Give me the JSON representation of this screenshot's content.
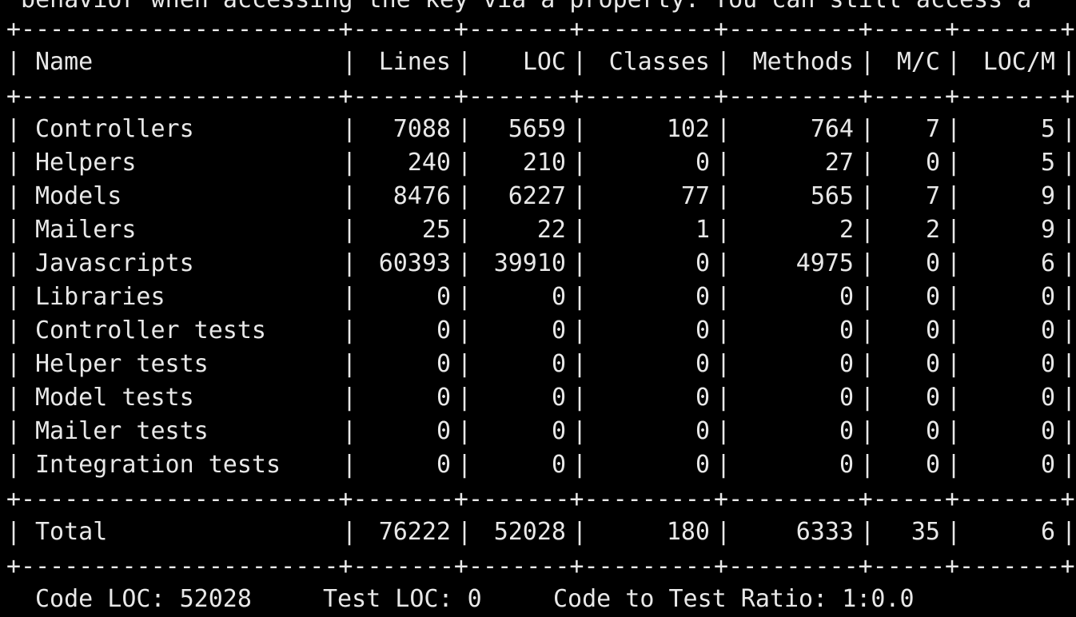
{
  "top_text": " behavior when accessing the key via a property. You can still access a",
  "separator": "+----------------------+-------+-------+---------+---------+-----+-------+",
  "columns": [
    "Name",
    "Lines",
    "LOC",
    "Classes",
    "Methods",
    "M/C",
    "LOC/M"
  ],
  "rows": [
    {
      "name": "Controllers",
      "lines": "7088",
      "loc": "5659",
      "classes": "102",
      "methods": "764",
      "mc": "7",
      "locm": "5"
    },
    {
      "name": "Helpers",
      "lines": "240",
      "loc": "210",
      "classes": "0",
      "methods": "27",
      "mc": "0",
      "locm": "5"
    },
    {
      "name": "Models",
      "lines": "8476",
      "loc": "6227",
      "classes": "77",
      "methods": "565",
      "mc": "7",
      "locm": "9"
    },
    {
      "name": "Mailers",
      "lines": "25",
      "loc": "22",
      "classes": "1",
      "methods": "2",
      "mc": "2",
      "locm": "9"
    },
    {
      "name": "Javascripts",
      "lines": "60393",
      "loc": "39910",
      "classes": "0",
      "methods": "4975",
      "mc": "0",
      "locm": "6"
    },
    {
      "name": "Libraries",
      "lines": "0",
      "loc": "0",
      "classes": "0",
      "methods": "0",
      "mc": "0",
      "locm": "0"
    },
    {
      "name": "Controller tests",
      "lines": "0",
      "loc": "0",
      "classes": "0",
      "methods": "0",
      "mc": "0",
      "locm": "0"
    },
    {
      "name": "Helper tests",
      "lines": "0",
      "loc": "0",
      "classes": "0",
      "methods": "0",
      "mc": "0",
      "locm": "0"
    },
    {
      "name": "Model tests",
      "lines": "0",
      "loc": "0",
      "classes": "0",
      "methods": "0",
      "mc": "0",
      "locm": "0"
    },
    {
      "name": "Mailer tests",
      "lines": "0",
      "loc": "0",
      "classes": "0",
      "methods": "0",
      "mc": "0",
      "locm": "0"
    },
    {
      "name": "Integration tests",
      "lines": "0",
      "loc": "0",
      "classes": "0",
      "methods": "0",
      "mc": "0",
      "locm": "0"
    }
  ],
  "total": {
    "name": "Total",
    "lines": "76222",
    "loc": "52028",
    "classes": "180",
    "methods": "6333",
    "mc": "35",
    "locm": "6"
  },
  "summary": {
    "code_loc_label": "Code LOC: 52028",
    "test_loc_label": "Test LOC: 0",
    "ratio_label": "Code to Test Ratio: 1:0.0"
  }
}
